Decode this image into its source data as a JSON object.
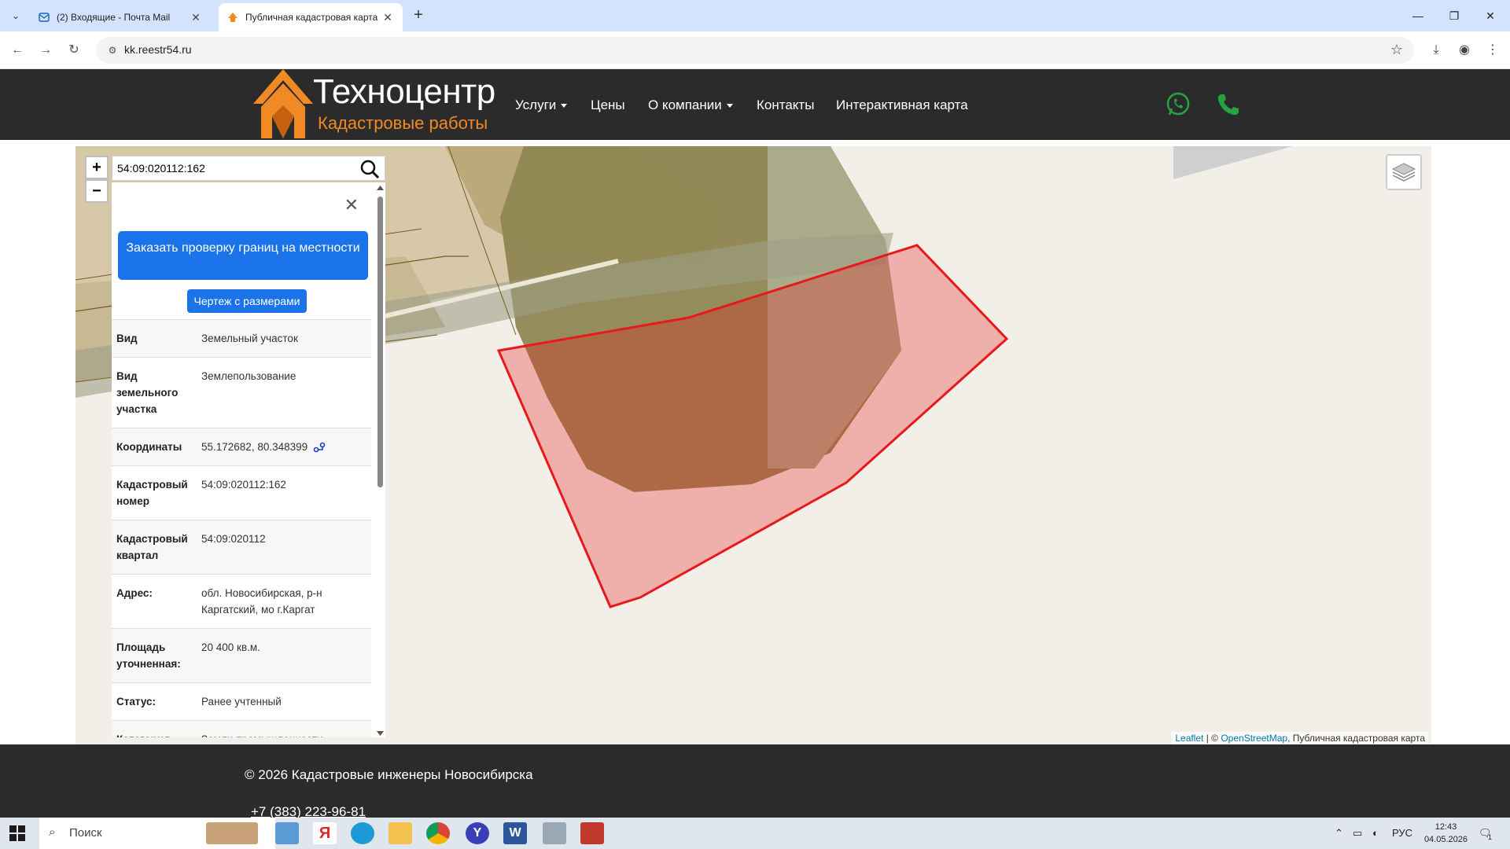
{
  "browser": {
    "tabs": [
      {
        "title": "(2) Входящие - Почта Mail",
        "active": false
      },
      {
        "title": "Публичная кадастровая карта",
        "active": true
      }
    ],
    "url": "kk.reestr54.ru"
  },
  "site": {
    "brand": "Техноцентр",
    "brand_sub": "Кадастровые работы",
    "menu": [
      {
        "label": "Услуги",
        "dropdown": true
      },
      {
        "label": "Цены",
        "dropdown": false
      },
      {
        "label": "О компании",
        "dropdown": true
      },
      {
        "label": "Контакты",
        "dropdown": false
      },
      {
        "label": "Интерактивная карта",
        "dropdown": false
      }
    ],
    "icons": [
      "whatsapp-icon",
      "phone-icon"
    ],
    "colors": {
      "header_bg": "#2b2b2b",
      "brand_orange": "#f08a24",
      "button_blue": "#1a73e8",
      "parcel_red": "#e8191c"
    }
  },
  "map": {
    "zoom_in": "+",
    "zoom_out": "−",
    "search_value": "54:09:020112:162",
    "panel": {
      "order_button": "Заказать проверку границ на местности",
      "drawing_button": "Чертеж с размерами",
      "props": [
        {
          "k": "Вид",
          "v": "Земельный участок"
        },
        {
          "k": "Вид земельного участка",
          "v": "Землепользование"
        },
        {
          "k": "Координаты",
          "v": "55.172682, 80.348399"
        },
        {
          "k": "Кадастровый номер",
          "v": "54:09:020112:162"
        },
        {
          "k": "Кадастровый квартал",
          "v": "54:09:020112"
        },
        {
          "k": "Адрес:",
          "v": "обл. Новосибирская, р-н Каргатский, мо г.Каргат"
        },
        {
          "k": "Площадь уточненная:",
          "v": "20 400 кв.м."
        },
        {
          "k": "Статус:",
          "v": "Ранее учтенный"
        },
        {
          "k": "Категория земель",
          "v": "Земли промышленности, энергетики, транспорта, связи, радиовещания, телевидения,"
        }
      ]
    },
    "attribution": {
      "leaflet": "Leaflet",
      "sep": " | © ",
      "osm": "OpenStreetMap",
      "rest": ", Публичная кадастровая карта"
    }
  },
  "footer": {
    "copyright": "© 2026 Кадастровые инженеры Новосибирска",
    "phone": "+7 (383) 223-96-81"
  },
  "taskbar": {
    "search_placeholder": "Поиск",
    "lang": "РУС",
    "time": "12:43",
    "date": "04.05.2026",
    "notif_count": "1"
  }
}
